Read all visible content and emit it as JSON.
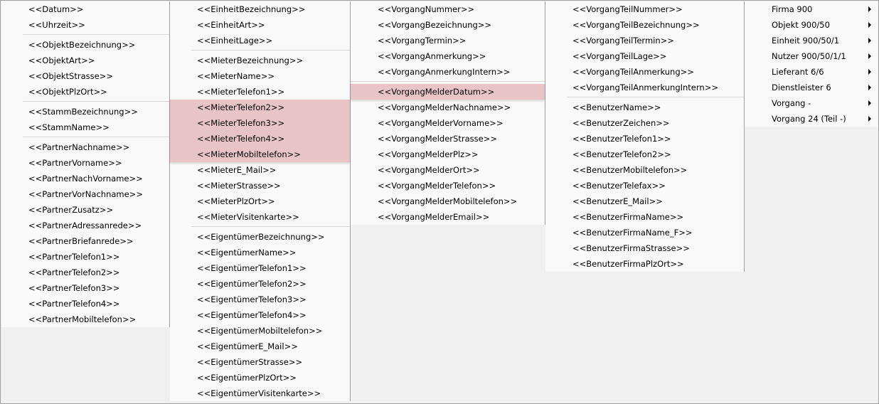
{
  "menus": [
    {
      "items": [
        {
          "type": "item",
          "label": "<<Datum>>"
        },
        {
          "type": "item",
          "label": "<<Uhrzeit>>"
        },
        {
          "type": "sep"
        },
        {
          "type": "item",
          "label": "<<ObjektBezeichnung>>"
        },
        {
          "type": "item",
          "label": "<<ObjektArt>>"
        },
        {
          "type": "item",
          "label": "<<ObjektStrasse>>"
        },
        {
          "type": "item",
          "label": "<<ObjektPlzOrt>>"
        },
        {
          "type": "sep"
        },
        {
          "type": "item",
          "label": "<<StammBezeichnung>>"
        },
        {
          "type": "item",
          "label": "<<StammName>>"
        },
        {
          "type": "sep"
        },
        {
          "type": "item",
          "label": "<<PartnerNachname>>"
        },
        {
          "type": "item",
          "label": "<<PartnerVorname>>"
        },
        {
          "type": "item",
          "label": "<<PartnerNachVorname>>"
        },
        {
          "type": "item",
          "label": "<<PartnerVorNachname>>"
        },
        {
          "type": "item",
          "label": "<<PartnerZusatz>>"
        },
        {
          "type": "item",
          "label": "<<PartnerAdressanrede>>"
        },
        {
          "type": "item",
          "label": "<<PartnerBriefanrede>>"
        },
        {
          "type": "item",
          "label": "<<PartnerTelefon1>>"
        },
        {
          "type": "item",
          "label": "<<PartnerTelefon2>>"
        },
        {
          "type": "item",
          "label": "<<PartnerTelefon3>>"
        },
        {
          "type": "item",
          "label": "<<PartnerTelefon4>>"
        },
        {
          "type": "item",
          "label": "<<PartnerMobiltelefon>>"
        }
      ]
    },
    {
      "items": [
        {
          "type": "item",
          "label": "<<EinheitBezeichnung>>"
        },
        {
          "type": "item",
          "label": "<<EinheitArt>>"
        },
        {
          "type": "item",
          "label": "<<EinheitLage>>"
        },
        {
          "type": "sep"
        },
        {
          "type": "item",
          "label": "<<MieterBezeichnung>>"
        },
        {
          "type": "item",
          "label": "<<MieterName>>"
        },
        {
          "type": "item",
          "label": "<<MieterTelefon1>>"
        },
        {
          "type": "item",
          "label": "<<MieterTelefon2>>",
          "highlighted": true
        },
        {
          "type": "item",
          "label": "<<MieterTelefon3>>",
          "highlighted": true
        },
        {
          "type": "item",
          "label": "<<MieterTelefon4>>",
          "highlighted": true
        },
        {
          "type": "item",
          "label": "<<MieterMobiltelefon>>",
          "highlighted": true
        },
        {
          "type": "item",
          "label": "<<MieterE_Mail>>"
        },
        {
          "type": "item",
          "label": "<<MieterStrasse>>"
        },
        {
          "type": "item",
          "label": "<<MieterPlzOrt>>"
        },
        {
          "type": "item",
          "label": "<<MieterVisitenkarte>>"
        },
        {
          "type": "sep"
        },
        {
          "type": "item",
          "label": "<<EigentümerBezeichnung>>"
        },
        {
          "type": "item",
          "label": "<<EigentümerName>>"
        },
        {
          "type": "item",
          "label": "<<EigentümerTelefon1>>"
        },
        {
          "type": "item",
          "label": "<<EigentümerTelefon2>>"
        },
        {
          "type": "item",
          "label": "<<EigentümerTelefon3>>"
        },
        {
          "type": "item",
          "label": "<<EigentümerTelefon4>>"
        },
        {
          "type": "item",
          "label": "<<EigentümerMobiltelefon>>"
        },
        {
          "type": "item",
          "label": "<<EigentümerE_Mail>>"
        },
        {
          "type": "item",
          "label": "<<EigentümerStrasse>>"
        },
        {
          "type": "item",
          "label": "<<EigentümerPlzOrt>>"
        },
        {
          "type": "item",
          "label": "<<EigentümerVisitenkarte>>"
        }
      ]
    },
    {
      "items": [
        {
          "type": "item",
          "label": "<<VorgangNummer>>"
        },
        {
          "type": "item",
          "label": "<<VorgangBezeichnung>>"
        },
        {
          "type": "item",
          "label": "<<VorgangTermin>>"
        },
        {
          "type": "item",
          "label": "<<VorgangAnmerkung>>"
        },
        {
          "type": "item",
          "label": "<<VorgangAnmerkungIntern>>"
        },
        {
          "type": "sep"
        },
        {
          "type": "item",
          "label": "<<VorgangMelderDatum>>",
          "highlighted": true
        },
        {
          "type": "item",
          "label": "<<VorgangMelderNachname>>"
        },
        {
          "type": "item",
          "label": "<<VorgangMelderVorname>>"
        },
        {
          "type": "item",
          "label": "<<VorgangMelderStrasse>>"
        },
        {
          "type": "item",
          "label": "<<VorgangMelderPlz>>"
        },
        {
          "type": "item",
          "label": "<<VorgangMelderOrt>>"
        },
        {
          "type": "item",
          "label": "<<VorgangMelderTelefon>>"
        },
        {
          "type": "item",
          "label": "<<VorgangMelderMobiltelefon>>"
        },
        {
          "type": "item",
          "label": "<<VorgangMelderEmail>>"
        }
      ]
    },
    {
      "items": [
        {
          "type": "item",
          "label": "<<VorgangTeilNummer>>"
        },
        {
          "type": "item",
          "label": "<<VorgangTeilBezeichnung>>"
        },
        {
          "type": "item",
          "label": "<<VorgangTeilTermin>>"
        },
        {
          "type": "item",
          "label": "<<VorgangTeilLage>>"
        },
        {
          "type": "item",
          "label": "<<VorgangTeilAnmerkung>>"
        },
        {
          "type": "item",
          "label": "<<VorgangTeilAnmerkungIntern>>"
        },
        {
          "type": "sep"
        },
        {
          "type": "item",
          "label": "<<BenutzerName>>"
        },
        {
          "type": "item",
          "label": "<<BenutzerZeichen>>"
        },
        {
          "type": "item",
          "label": "<<BenutzerTelefon1>>"
        },
        {
          "type": "item",
          "label": "<<BenutzerTelefon2>>"
        },
        {
          "type": "item",
          "label": "<<BenutzerMobiltelefon>>"
        },
        {
          "type": "item",
          "label": "<<BenutzerTelefax>>"
        },
        {
          "type": "item",
          "label": "<<BenutzerE_Mail>>"
        },
        {
          "type": "item",
          "label": "<<BenutzerFirmaName>>"
        },
        {
          "type": "item",
          "label": "<<BenutzerFirmaName_F>>"
        },
        {
          "type": "item",
          "label": "<<BenutzerFirmaStrasse>>"
        },
        {
          "type": "item",
          "label": "<<BenutzerFirmaPlzOrt>>"
        }
      ]
    },
    {
      "items": [
        {
          "type": "item",
          "label": "Firma 900",
          "submenu": true,
          "icon": "submenu-arrow-icon"
        },
        {
          "type": "item",
          "label": "Objekt 900/50",
          "submenu": true,
          "icon": "submenu-arrow-icon"
        },
        {
          "type": "item",
          "label": "Einheit 900/50/1",
          "submenu": true,
          "icon": "submenu-arrow-icon"
        },
        {
          "type": "item",
          "label": "Nutzer 900/50/1/1",
          "submenu": true,
          "icon": "submenu-arrow-icon"
        },
        {
          "type": "item",
          "label": "Lieferant 6/6",
          "submenu": true,
          "icon": "submenu-arrow-icon"
        },
        {
          "type": "item",
          "label": "Dienstleister 6",
          "submenu": true,
          "icon": "submenu-arrow-icon"
        },
        {
          "type": "item",
          "label": "Vorgang -",
          "submenu": true,
          "icon": "submenu-arrow-icon"
        },
        {
          "type": "item",
          "label": "Vorgang 24 (Teil -)",
          "submenu": true,
          "icon": "submenu-arrow-icon"
        }
      ]
    }
  ],
  "colors": {
    "menu_background": "#f9f9f9",
    "highlight": "#e8c4c6",
    "separator": "#d8d8d8",
    "backdrop": "#f0f0f0"
  }
}
